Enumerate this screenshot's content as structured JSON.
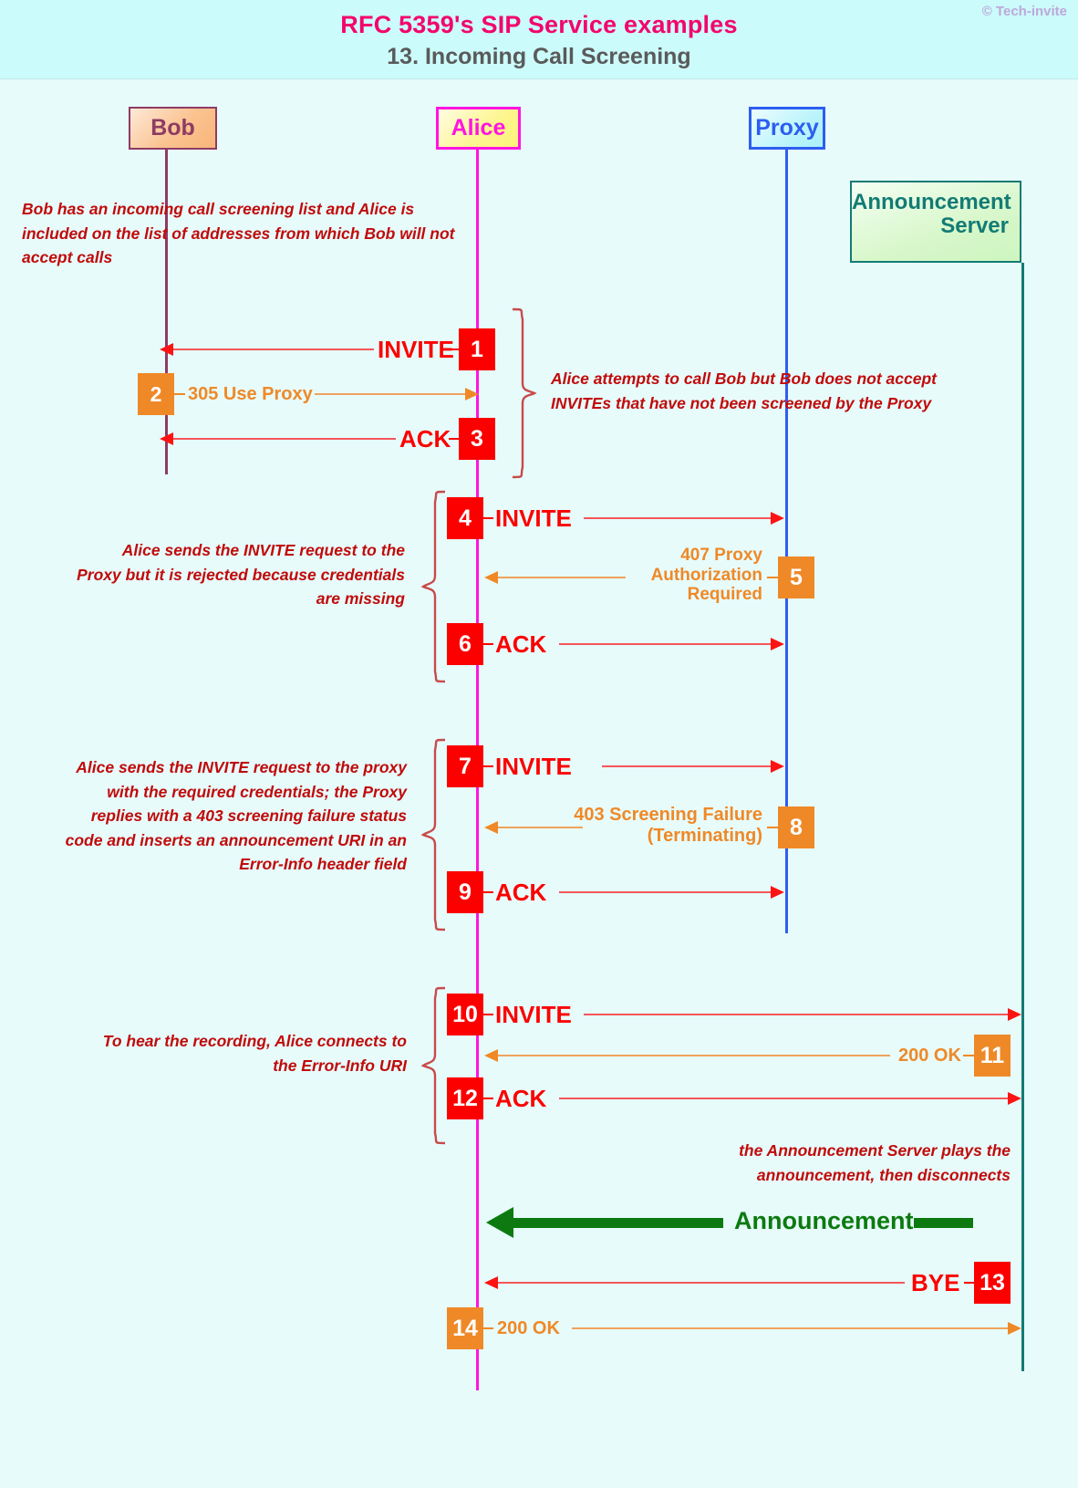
{
  "header": {
    "title": "RFC 5359's SIP Service examples",
    "subtitle": "13. Incoming Call Screening",
    "copyright": "© Tech-invite"
  },
  "actors": [
    {
      "id": "bob",
      "label": "Bob"
    },
    {
      "id": "alice",
      "label": "Alice"
    },
    {
      "id": "proxy",
      "label": "Proxy"
    },
    {
      "id": "ann",
      "label": "Announcement\nServer",
      "line1": "Announcement",
      "line2": "Server"
    }
  ],
  "notes": [
    {
      "id": "note1",
      "text": "Bob has an incoming call screening list and Alice is included on the list of addresses from which Bob will not accept calls"
    },
    {
      "id": "note2",
      "text": "Alice attempts to call Bob but Bob does not accept INVITEs that have not been screened by the Proxy"
    },
    {
      "id": "note3",
      "text": "Alice sends the INVITE request to the Proxy but it is rejected because credentials are missing"
    },
    {
      "id": "note4",
      "text": "Alice sends the INVITE request to the proxy with the required credentials; the Proxy replies with a 403 screening failure status code and inserts an announcement URI in an Error-Info header field"
    },
    {
      "id": "note5",
      "text": "To hear the recording, Alice connects to the Error-Info URI"
    },
    {
      "id": "note6",
      "text": "the Announcement Server plays the announcement, then disconnects"
    }
  ],
  "messages": [
    {
      "num": "1",
      "label": "INVITE",
      "kind": "request",
      "from": "alice",
      "to": "bob"
    },
    {
      "num": "2",
      "label": "305 Use Proxy",
      "kind": "response",
      "from": "bob",
      "to": "alice"
    },
    {
      "num": "3",
      "label": "ACK",
      "kind": "request",
      "from": "alice",
      "to": "bob"
    },
    {
      "num": "4",
      "label": "INVITE",
      "kind": "request",
      "from": "alice",
      "to": "proxy"
    },
    {
      "num": "5",
      "label": "407 Proxy\nAuthorization\nRequired",
      "kind": "response",
      "from": "proxy",
      "to": "alice"
    },
    {
      "num": "6",
      "label": "ACK",
      "kind": "request",
      "from": "alice",
      "to": "proxy"
    },
    {
      "num": "7",
      "label": "INVITE",
      "kind": "request",
      "from": "alice",
      "to": "proxy"
    },
    {
      "num": "8",
      "label": "403 Screening Failure\n(Terminating)",
      "kind": "response",
      "from": "proxy",
      "to": "alice"
    },
    {
      "num": "9",
      "label": "ACK",
      "kind": "request",
      "from": "alice",
      "to": "proxy"
    },
    {
      "num": "10",
      "label": "INVITE",
      "kind": "request",
      "from": "alice",
      "to": "ann"
    },
    {
      "num": "11",
      "label": "200 OK",
      "kind": "response",
      "from": "ann",
      "to": "alice"
    },
    {
      "num": "12",
      "label": "ACK",
      "kind": "request",
      "from": "alice",
      "to": "ann"
    },
    {
      "num": "13",
      "label": "BYE",
      "kind": "request",
      "from": "ann",
      "to": "alice"
    },
    {
      "num": "14",
      "label": "200 OK",
      "kind": "response",
      "from": "alice",
      "to": "ann"
    }
  ],
  "media": {
    "label": "Announcement",
    "from": "ann",
    "to": "alice"
  },
  "colors": {
    "background": "#e7fbfb",
    "header_band": "#ccfbfb",
    "title": "#f2066c",
    "subtitle": "#5a5a5a",
    "request": "#fc0000",
    "response": "#ef8927",
    "note": "#c10a0a",
    "media": "#0c7a10",
    "bob": "#8e3b63",
    "alice": "#ff15e0",
    "proxy": "#2d5ef0",
    "announcement_server": "#127b74"
  }
}
